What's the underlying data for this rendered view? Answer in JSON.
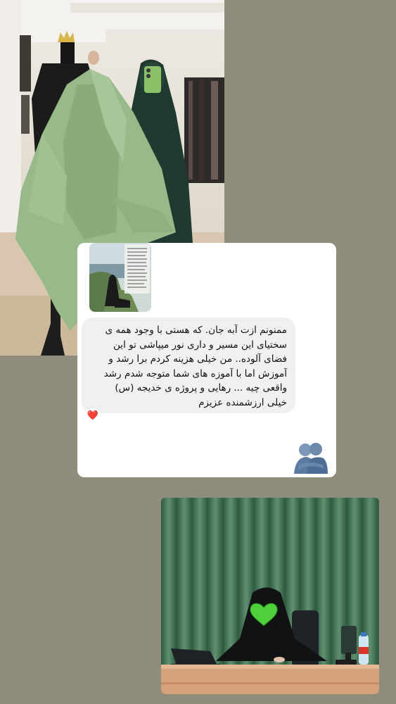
{
  "story": {
    "background_color": "#8f8c7b",
    "top_photo": {
      "subject": "light green cape with hood displayed on mannequin, person taking mirror selfie in dark green chador",
      "icons": [
        "crown-icon",
        "phone-icon"
      ]
    },
    "chat_card": {
      "reply_thumbnail": {
        "subject": "woman in black chador sitting on rock by the sea with caption text"
      },
      "message": {
        "text": "ممنونم ازت آبه جان. که هستی با وجود همه ی\nسختیای این مسیر و داری نور میپاشی تو این\nفضای آلوده.. من خیلی هزینه کردم برا رشد و\nآموزش اما با آموزه های شما متوجه شدم رشد\nواقعی چیه ... رهایی و پروژه ی خدیجه (س)\nخیلی ارزشمنده عزیزم",
        "reaction": "❤️"
      },
      "sticker": "hugging-people-icon"
    },
    "bottom_photo": {
      "subject": "woman in black chador seated at desk in front of green curtain, face covered by green heart",
      "icons": [
        "green-heart-icon",
        "laptop-icon",
        "phone-stand-icon",
        "water-bottle-icon"
      ]
    }
  }
}
